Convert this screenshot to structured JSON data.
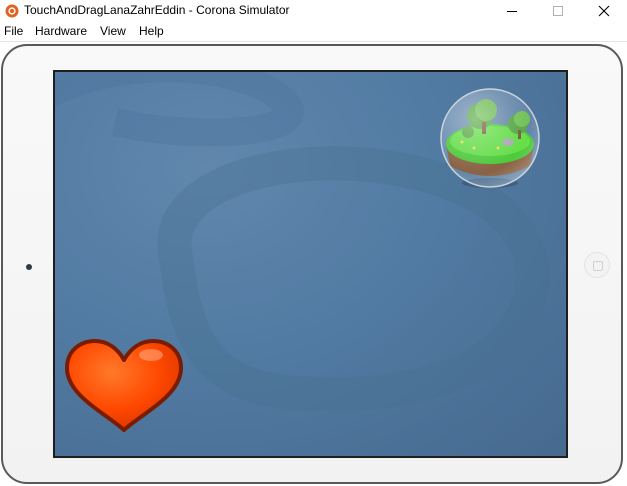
{
  "window": {
    "title": "TouchAndDragLanaZahrEddin - Corona Simulator"
  },
  "menu": {
    "items": [
      "File",
      "Hardware",
      "View",
      "Help"
    ]
  },
  "colors": {
    "screen_blue": "#527ba3",
    "heart_red": "#ff4a00",
    "heart_outline": "#7a1c00",
    "island_green": "#33c41a",
    "island_soil": "#7a4a25",
    "device_frame": "#f4f4f4"
  },
  "icons": {
    "app": "corona-app-icon",
    "minimize": "minimize-icon",
    "maximize": "maximize-icon",
    "close": "close-icon",
    "home": "home-button-icon"
  }
}
